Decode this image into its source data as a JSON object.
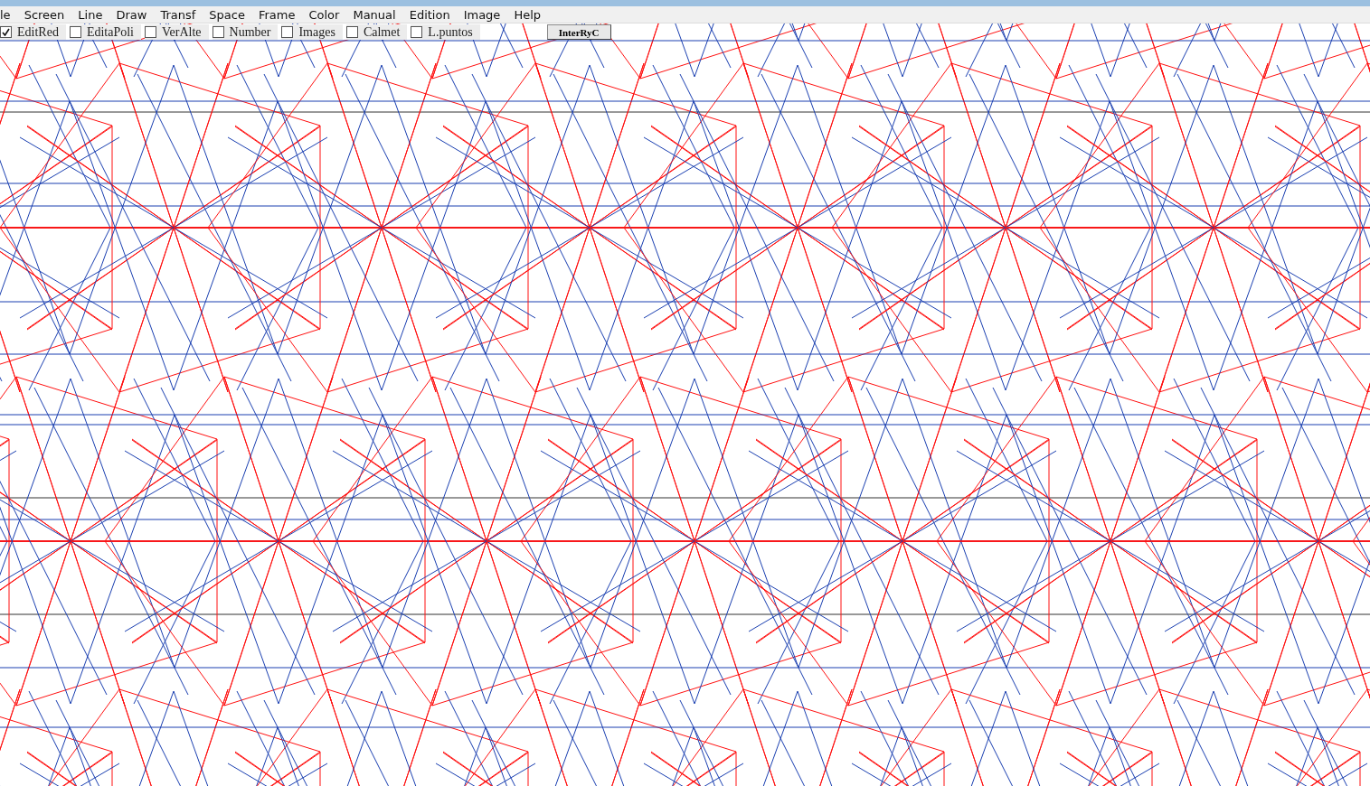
{
  "menu": [
    {
      "label": "le"
    },
    {
      "label": "Screen"
    },
    {
      "label": "Line"
    },
    {
      "label": "Draw"
    },
    {
      "label": "Transf"
    },
    {
      "label": "Space"
    },
    {
      "label": "Frame"
    },
    {
      "label": "Color"
    },
    {
      "label": "Manual"
    },
    {
      "label": "Edition"
    },
    {
      "label": "Image"
    },
    {
      "label": "Help"
    }
  ],
  "toolbar": {
    "checkboxes": [
      {
        "label": "EditRed",
        "checked": true
      },
      {
        "label": "EditaPoli",
        "checked": false
      },
      {
        "label": "VerAlte",
        "checked": false
      },
      {
        "label": "Number",
        "checked": false
      },
      {
        "label": "Images",
        "checked": false
      },
      {
        "label": "Calmet",
        "checked": false
      },
      {
        "label": "L.puntos",
        "checked": false
      }
    ],
    "button": "InterRyC"
  }
}
